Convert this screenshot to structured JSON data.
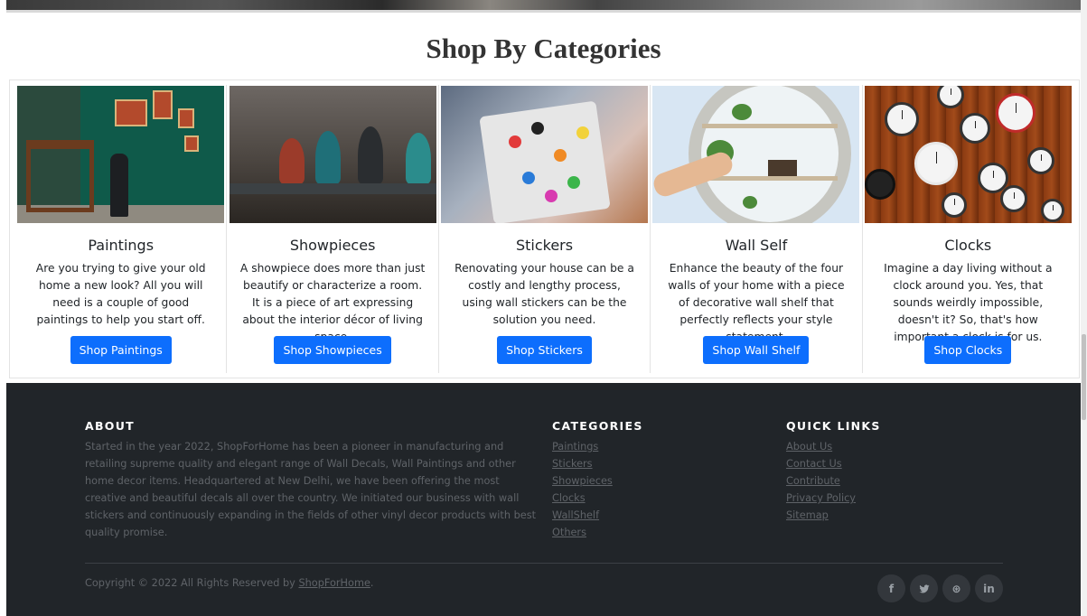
{
  "section": {
    "title": "Shop By Categories"
  },
  "cards": [
    {
      "title": "Paintings",
      "text": "Are you trying to give your old home a new look? All you will need is a couple of good paintings to help you start off.",
      "button": "Shop Paintings"
    },
    {
      "title": "Showpieces",
      "text": "A showpiece does more than just beautify or characterize a room. It is a piece of art expressing about the interior décor of living space.",
      "button": "Shop Showpieces"
    },
    {
      "title": "Stickers",
      "text": "Renovating your house can be a costly and lengthy process, using wall stickers can be the solution you need.",
      "button": "Shop Stickers"
    },
    {
      "title": "Wall Self",
      "text": "Enhance the beauty of the four walls of your home with a piece of decorative wall shelf that perfectly reflects your style statement.",
      "button": "Shop Wall Shelf"
    },
    {
      "title": "Clocks",
      "text": "Imagine a day living without a clock around you. Yes, that sounds weirdly impossible, doesn't it? So, that's how important a clock is for us.",
      "button": "Shop Clocks"
    }
  ],
  "footer": {
    "about": {
      "heading": "ABOUT",
      "text": "Started in the year 2022, ShopForHome has been a pioneer in manufacturing and retailing supreme quality and elegant range of Wall Decals, Wall Paintings and other home decor items. Headquartered at New Delhi, we have been offering the most creative and beautiful decals all over the country. We initiated our business with wall stickers and continuously expanding in the fields of other vinyl decor products with best quality promise."
    },
    "categories": {
      "heading": "CATEGORIES",
      "links": [
        "Paintings",
        "Stickers",
        "Showpieces",
        "Clocks",
        "WallShelf",
        "Others"
      ]
    },
    "quick_links": {
      "heading": "QUICK LINKS",
      "links": [
        "About Us",
        "Contact Us",
        "Contribute",
        "Privacy Policy",
        "Sitemap"
      ]
    },
    "copyright_prefix": "Copyright © 2022 All Rights Reserved by ",
    "copyright_link": "ShopForHome",
    "copyright_suffix": ".",
    "socials": [
      {
        "icon": "facebook-icon",
        "glyph": "f"
      },
      {
        "icon": "twitter-icon",
        "glyph": "🐦︎"
      },
      {
        "icon": "dribbble-icon",
        "glyph": "⊛"
      },
      {
        "icon": "linkedin-icon",
        "glyph": "in"
      }
    ]
  },
  "colors": {
    "primary_button": "#0d6efd",
    "footer_bg": "#212529"
  }
}
